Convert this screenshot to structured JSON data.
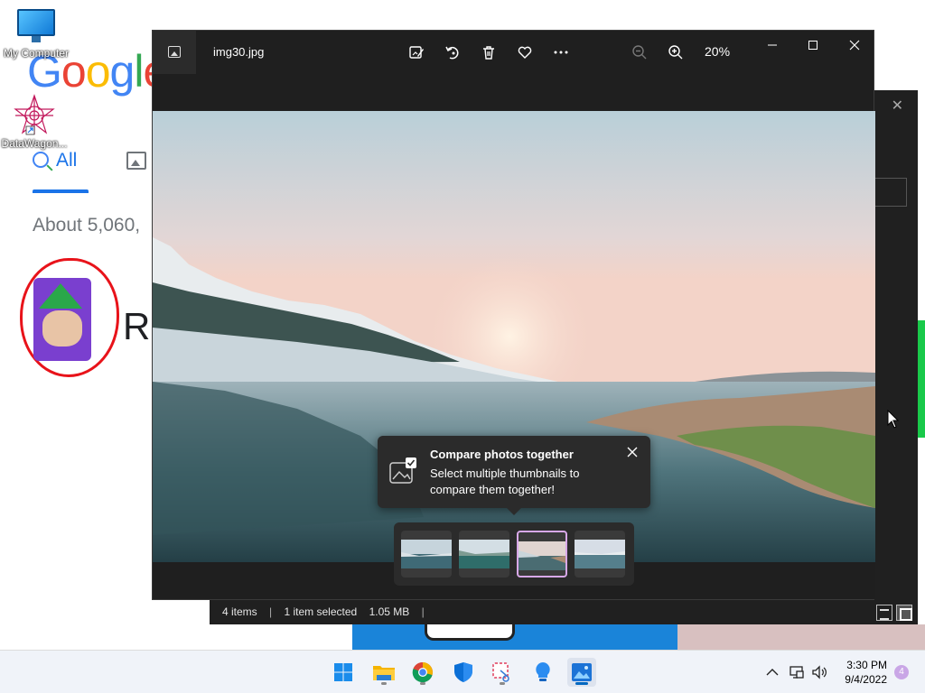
{
  "browser_page": {
    "logo_text": "Google",
    "logo_letters": [
      {
        "ch": "G",
        "color": "#4285F4"
      },
      {
        "ch": "o",
        "color": "#EA4335"
      },
      {
        "ch": "o",
        "color": "#FBBC05"
      },
      {
        "ch": "g",
        "color": "#4285F4"
      },
      {
        "ch": "l",
        "color": "#34A853"
      },
      {
        "ch": "e",
        "color": "#EA4335"
      }
    ],
    "tab_all_label": "All",
    "results_text": "About 5,060,",
    "partial_result_letter": "R"
  },
  "desktop": {
    "icons": [
      {
        "label": "My Computer",
        "icon": "monitor-icon"
      },
      {
        "label": "DataWagon...",
        "icon": "datawagon-star-icon"
      }
    ]
  },
  "photos": {
    "file_name": "img30.jpg",
    "zoom_level": "20%",
    "toolbar": [
      {
        "name": "edit-image-button",
        "icon": "edit-image-icon"
      },
      {
        "name": "rotate-button",
        "icon": "rotate-icon"
      },
      {
        "name": "delete-button",
        "icon": "trash-icon"
      },
      {
        "name": "favorite-button",
        "icon": "heart-icon"
      },
      {
        "name": "more-options-button",
        "icon": "ellipsis-icon"
      },
      {
        "name": "zoom-out-button",
        "icon": "zoom-out-icon"
      },
      {
        "name": "zoom-in-button",
        "icon": "zoom-in-icon"
      }
    ],
    "tip": {
      "title": "Compare photos together",
      "body": "Select multiple thumbnails to compare them together!"
    },
    "filmstrip": {
      "thumbnail_count": 4,
      "selected_index": 2
    }
  },
  "explorer_status": {
    "items": "4 items",
    "selected": "1 item selected",
    "size": "1.05 MB",
    "separator": "|"
  },
  "taskbar": {
    "apps": [
      "start-icon",
      "file-explorer-icon",
      "chrome-icon",
      "defender-icon",
      "snipping-tool-icon",
      "tips-icon",
      "photos-icon"
    ],
    "active_app": "photos-icon",
    "time": "3:30 PM",
    "date": "9/4/2022",
    "notification_count": "4"
  },
  "colors": {
    "photos_bg": "#1f1f1f",
    "tip_bg": "#2b2b2b",
    "accent": "#0067c0",
    "thumb_selected": "#d8a8e8",
    "annotation_red": "#e8131a"
  }
}
